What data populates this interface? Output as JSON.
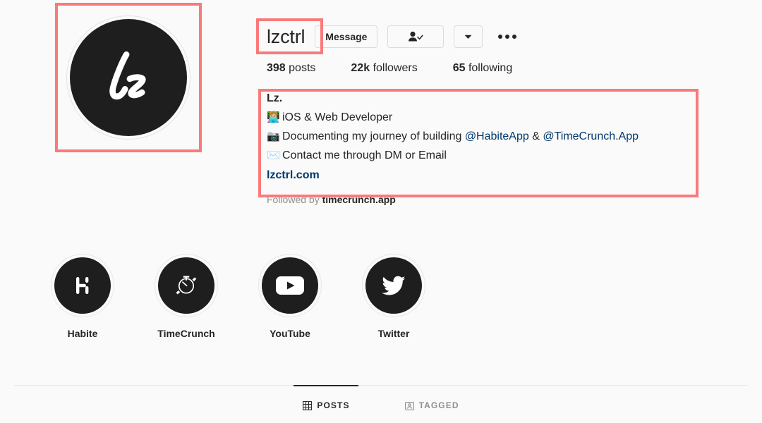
{
  "profile": {
    "username": "lzctrl",
    "avatar_icon": "lz-script-logo",
    "actions": {
      "message_label": "Message",
      "following_icon": "person-check-icon",
      "dropdown_icon": "chevron-down-icon",
      "options_icon": "ellipsis-icon"
    },
    "stats": [
      {
        "value": "398",
        "label": "posts",
        "name": "posts"
      },
      {
        "value": "22k",
        "label": "followers",
        "name": "followers"
      },
      {
        "value": "65",
        "label": "following",
        "name": "following"
      }
    ],
    "bio": {
      "display_name": "Lz.",
      "lines": [
        {
          "emoji": "👩🏼‍💻",
          "emoji_name": "woman-technologist-icon",
          "text": "iOS & Web Developer"
        },
        {
          "emoji": "📷",
          "emoji_name": "camera-icon",
          "text_before": "Documenting my journey of building ",
          "mention_1": "@HabiteApp",
          "text_middle": " & ",
          "mention_2": "@TimeCrunch.App"
        },
        {
          "emoji": "✉️",
          "emoji_name": "envelope-icon",
          "text": "Contact me through DM or Email"
        }
      ],
      "website": "lzctrl.com"
    },
    "followed_by": {
      "prefix": "Followed by",
      "names": "timecrunch.app"
    }
  },
  "highlights": [
    {
      "label": "Habite",
      "icon": "habite-h-logo-icon"
    },
    {
      "label": "TimeCrunch",
      "icon": "stopwatch-icon"
    },
    {
      "label": "YouTube",
      "icon": "youtube-play-icon"
    },
    {
      "label": "Twitter",
      "icon": "twitter-bird-icon"
    }
  ],
  "tabs": [
    {
      "label": "POSTS",
      "icon": "grid-icon",
      "active": true
    },
    {
      "label": "TAGGED",
      "icon": "tagged-person-icon",
      "active": false
    }
  ],
  "colors": {
    "background": "#fafafa",
    "text": "#262626",
    "muted": "#8e8e8e",
    "link": "#00376b",
    "highlight_box": "#fa7a7a",
    "circle_dark": "#1e1e1e",
    "border": "#dbdbdb"
  }
}
